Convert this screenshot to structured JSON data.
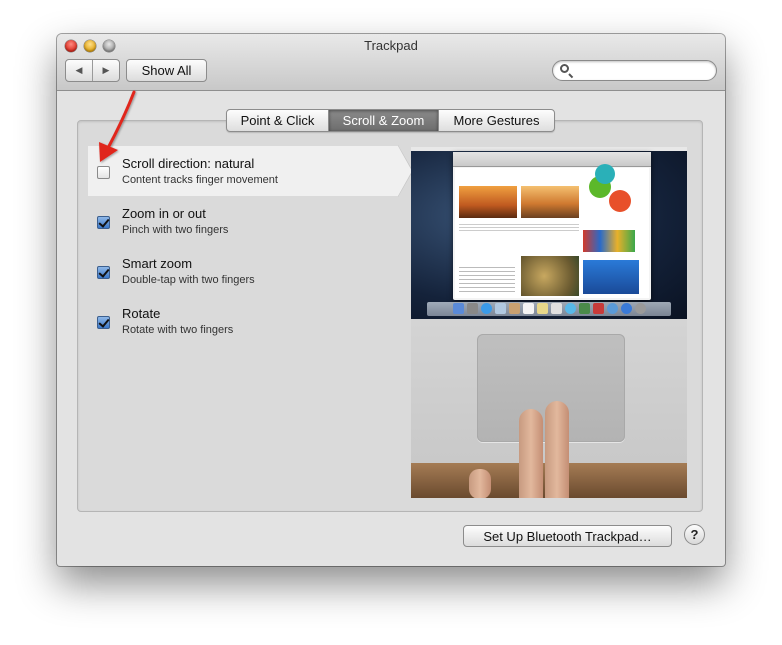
{
  "window": {
    "title": "Trackpad"
  },
  "toolbar": {
    "back_symbol": "◀",
    "forward_symbol": "▶",
    "show_all_label": "Show All",
    "search_placeholder": ""
  },
  "tabs": [
    {
      "label": "Point & Click",
      "active": false
    },
    {
      "label": "Scroll & Zoom",
      "active": true
    },
    {
      "label": "More Gestures",
      "active": false
    }
  ],
  "options": [
    {
      "title": "Scroll direction: natural",
      "subtitle": "Content tracks finger movement",
      "checked": false,
      "highlighted": true
    },
    {
      "title": "Zoom in or out",
      "subtitle": "Pinch with two fingers",
      "checked": true,
      "highlighted": false
    },
    {
      "title": "Smart zoom",
      "subtitle": "Double-tap with two fingers",
      "checked": true,
      "highlighted": false
    },
    {
      "title": "Rotate",
      "subtitle": "Rotate with two fingers",
      "checked": true,
      "highlighted": false
    }
  ],
  "footer": {
    "setup_label": "Set Up Bluetooth Trackpad…",
    "help_label": "?"
  },
  "colors": {
    "accent_checkbox": "#3b78c8",
    "annotation_arrow": "#e0281e",
    "active_tab": "#6d6d6d"
  }
}
